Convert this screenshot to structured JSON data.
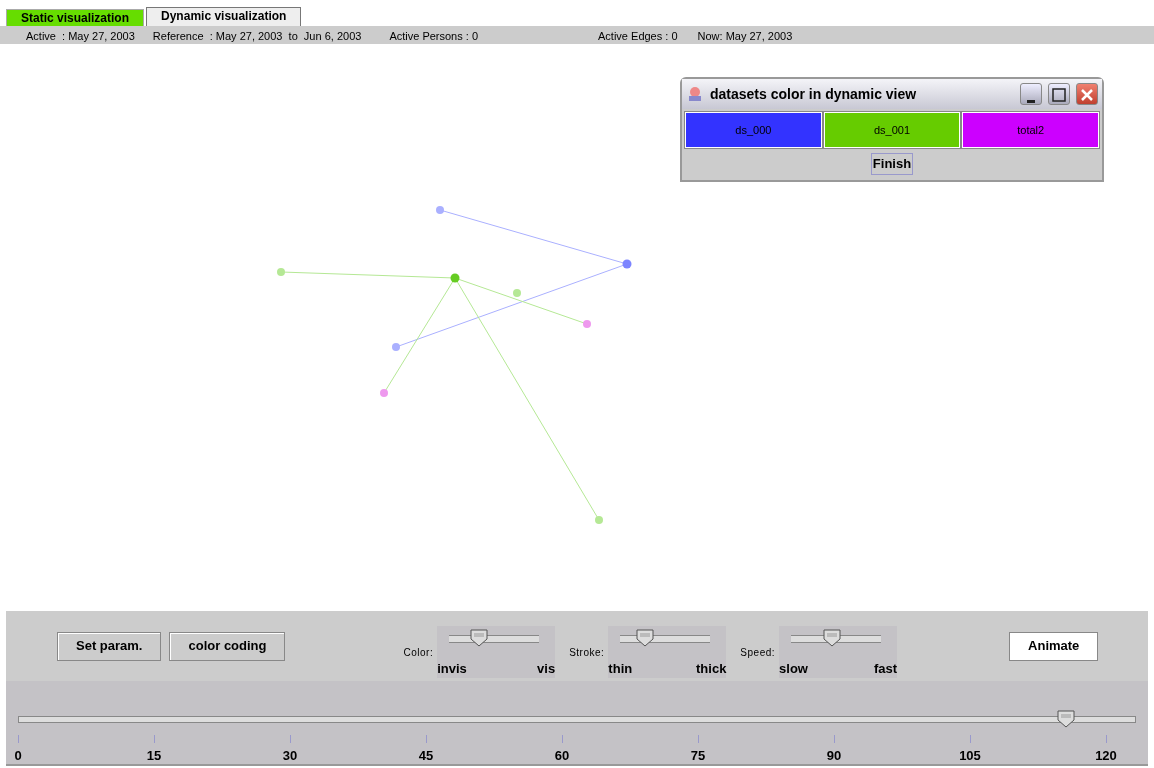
{
  "tabs": [
    {
      "label": "Static visualization",
      "selected": false,
      "color": "#66dd00"
    },
    {
      "label": "Dynamic visualization",
      "selected": true,
      "color": "#eeeeee"
    }
  ],
  "status_bar": [
    "Active  : May 27, 2003",
    "Reference  : May 27, 2003  to  Jun 6, 2003",
    "Active Persons : 0",
    "Active Edges : 0",
    "Now: May 27, 2003"
  ],
  "dialog": {
    "title": "datasets color in dynamic view",
    "datasets": [
      {
        "label": "ds_000",
        "color": "#3333ff"
      },
      {
        "label": "ds_001",
        "color": "#66cc00"
      },
      {
        "label": "total2",
        "color": "#cc00ff"
      }
    ],
    "finish": "Finish"
  },
  "buttons": [
    "Set param.",
    "color coding"
  ],
  "sliders": [
    {
      "label": "Color:",
      "min_label": "invis",
      "max_label": "vis",
      "level": 0.33
    },
    {
      "label": "Stroke:",
      "min_label": "thin",
      "max_label": "thick",
      "level": 0.27
    },
    {
      "label": "Speed:",
      "min_label": "slow",
      "max_label": "fast",
      "level": 0.45
    }
  ],
  "animate": "Animate",
  "timeline": {
    "level": 0.937,
    "ticks": [
      "0",
      "15",
      "30",
      "45",
      "60",
      "75",
      "90",
      "105",
      "120"
    ]
  }
}
